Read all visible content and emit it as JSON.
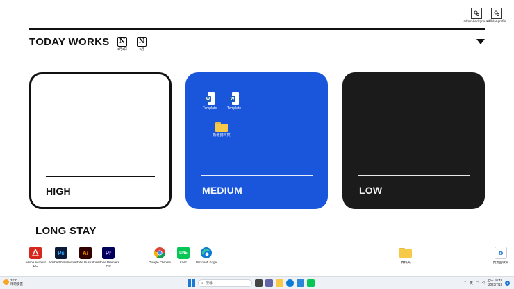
{
  "desktop_top_right": [
    {
      "label": "admin-background",
      "icon": "settings-shortcut-icon"
    },
    {
      "label": "cellular-profile",
      "icon": "settings-shortcut-icon"
    }
  ],
  "header": {
    "title": "TODAY  WORKS",
    "notion_shortcuts": [
      {
        "label": "1月1日",
        "icon": "notion-icon"
      },
      {
        "label": "9月",
        "icon": "notion-icon"
      }
    ]
  },
  "cards": {
    "high": {
      "label": "HIGH"
    },
    "medium": {
      "label": "MEDIUM",
      "files": [
        {
          "label": "Template",
          "icon": "word-document-icon"
        },
        {
          "label": "Template",
          "icon": "word-document-icon"
        },
        {
          "label": "新增資料夾",
          "icon": "folder-icon"
        }
      ]
    },
    "low": {
      "label": "LOW"
    }
  },
  "long_stay": {
    "title": "LONG STAY",
    "apps": [
      {
        "label": "Adobe Acrobat DC",
        "icon": "acrobat-icon",
        "glyph": "⟁",
        "bg": "#d7261c",
        "fg": "#ffffff"
      },
      {
        "label": "Adobe Photoshop",
        "icon": "photoshop-icon",
        "glyph": "Ps",
        "bg": "#0a1a38",
        "fg": "#31a8ff"
      },
      {
        "label": "Adobe Illustrator",
        "icon": "illustrator-icon",
        "glyph": "Ai",
        "bg": "#330000",
        "fg": "#ff9a00"
      },
      {
        "label": "Adobe Premiere Pro",
        "icon": "premiere-icon",
        "glyph": "Pr",
        "bg": "#00005b",
        "fg": "#d9a3ff"
      },
      {
        "label": "Google Chrome",
        "icon": "chrome-icon",
        "glyph": "",
        "bg": "#ffffff",
        "fg": "#000000"
      },
      {
        "label": "LINE",
        "icon": "line-icon",
        "glyph": "LINE",
        "bg": "#06c755",
        "fg": "#ffffff"
      },
      {
        "label": "Microsoft Edge",
        "icon": "edge-icon",
        "glyph": "",
        "bg": "#ffffff",
        "fg": "#000000"
      },
      {
        "label": "資料夾",
        "icon": "folder-icon",
        "glyph": "",
        "bg": "transparent",
        "fg": "#000"
      },
      {
        "label": "資源回收筒",
        "icon": "recycle-bin-icon",
        "glyph": "♻",
        "bg": "#ffffff",
        "fg": "#1f77d4"
      }
    ]
  },
  "taskbar": {
    "weather_temp": "32°C",
    "weather_desc": "晴時多雲",
    "search_placeholder": "搜尋",
    "ime_label": "英",
    "clock_time": "上午 10:48",
    "clock_date": "2023/7/13",
    "notification_count": "1"
  }
}
